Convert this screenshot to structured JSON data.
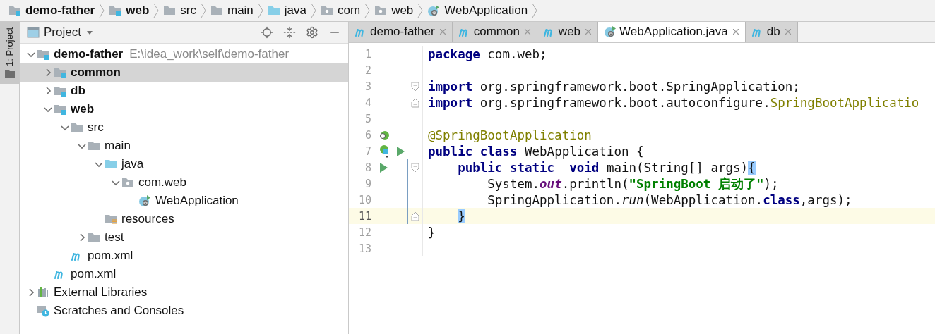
{
  "breadcrumbs": [
    {
      "label": "demo-father",
      "kind": "module"
    },
    {
      "label": "web",
      "kind": "module"
    },
    {
      "label": "src",
      "kind": "folder"
    },
    {
      "label": "main",
      "kind": "folder"
    },
    {
      "label": "java",
      "kind": "source"
    },
    {
      "label": "com",
      "kind": "package"
    },
    {
      "label": "web",
      "kind": "package"
    },
    {
      "label": "WebApplication",
      "kind": "class"
    }
  ],
  "side_tab": {
    "label": "1: Project",
    "selected": true
  },
  "project_panel": {
    "title": "Project"
  },
  "tree": [
    {
      "label": "demo-father",
      "hint": "E:\\idea_work\\self\\demo-father",
      "kind": "module",
      "expanded": true,
      "selected": false,
      "children": [
        {
          "label": "common",
          "kind": "module",
          "expanded": false,
          "selected": true
        },
        {
          "label": "db",
          "kind": "module",
          "expanded": false,
          "selected": false
        },
        {
          "label": "web",
          "kind": "module",
          "expanded": true,
          "selected": false,
          "children": [
            {
              "label": "src",
              "kind": "folder",
              "expanded": true,
              "selected": false,
              "children": [
                {
                  "label": "main",
                  "kind": "folder",
                  "expanded": true,
                  "selected": false,
                  "children": [
                    {
                      "label": "java",
                      "kind": "source",
                      "expanded": true,
                      "selected": false,
                      "children": [
                        {
                          "label": "com.web",
                          "kind": "package",
                          "expanded": true,
                          "selected": false,
                          "children": [
                            {
                              "label": "WebApplication",
                              "kind": "class",
                              "selected": false
                            }
                          ]
                        }
                      ]
                    },
                    {
                      "label": "resources",
                      "kind": "resources",
                      "selected": false
                    }
                  ]
                },
                {
                  "label": "test",
                  "kind": "folder",
                  "expanded": false,
                  "selected": false
                }
              ]
            },
            {
              "label": "pom.xml",
              "kind": "maven",
              "selected": false
            }
          ]
        },
        {
          "label": "pom.xml",
          "kind": "maven",
          "selected": false
        }
      ]
    },
    {
      "label": "External Libraries",
      "kind": "libraries",
      "expanded": false,
      "selected": false
    },
    {
      "label": "Scratches and Consoles",
      "kind": "scratches",
      "selected": false
    }
  ],
  "editor_tabs": [
    {
      "label": "demo-father",
      "kind": "maven",
      "selected": false
    },
    {
      "label": "common",
      "kind": "maven",
      "selected": false
    },
    {
      "label": "web",
      "kind": "maven",
      "selected": false
    },
    {
      "label": "WebApplication.java",
      "kind": "class",
      "selected": true
    },
    {
      "label": "db",
      "kind": "maven",
      "selected": false
    }
  ],
  "code": [
    {
      "number": "1",
      "current": false,
      "scope": false,
      "tokens": [
        {
          "text": "package",
          "kind": "keyword"
        },
        {
          "text": " com.web;",
          "kind": "plain"
        }
      ]
    },
    {
      "number": "2",
      "current": false,
      "scope": false
    },
    {
      "number": "3",
      "current": false,
      "scope": false,
      "fold_start": true,
      "tokens": [
        {
          "text": "import",
          "kind": "keyword"
        },
        {
          "text": " org.springframework.boot.SpringApplication;",
          "kind": "plain"
        }
      ]
    },
    {
      "number": "4",
      "current": false,
      "scope": false,
      "fold_end": true,
      "tokens": [
        {
          "text": "import",
          "kind": "keyword"
        },
        {
          "text": " org.springframework.boot.autoconfigure.",
          "kind": "plain"
        },
        {
          "text": "SpringBootApplicatio",
          "kind": "annotation"
        }
      ]
    },
    {
      "number": "5",
      "current": false,
      "scope": false
    },
    {
      "number": "6",
      "current": false,
      "scope": false,
      "marks": [
        {
          "kind": "bean"
        }
      ],
      "tokens": [
        {
          "text": "@SpringBootApplication",
          "kind": "annotation"
        }
      ]
    },
    {
      "number": "7",
      "current": false,
      "scope": false,
      "marks": [
        {
          "kind": "bean-class"
        },
        {
          "kind": "run"
        }
      ],
      "tokens": [
        {
          "text": "public",
          "kind": "keyword"
        },
        {
          "text": " class",
          "kind": "keyword"
        },
        {
          "text": " WebApplication {",
          "kind": "plain"
        }
      ]
    },
    {
      "number": "8",
      "current": false,
      "scope": true,
      "fold_start": true,
      "marks": [
        {
          "kind": "run"
        }
      ],
      "tokens": [
        {
          "text": "    public",
          "kind": "keyword"
        },
        {
          "text": " static",
          "kind": "keyword"
        },
        {
          "text": "  void",
          "kind": "keyword"
        },
        {
          "text": " main(String[] args)",
          "kind": "plain"
        },
        {
          "text": "{",
          "kind": "brace"
        }
      ]
    },
    {
      "number": "9",
      "current": false,
      "scope": true,
      "tokens": [
        {
          "text": "        System.",
          "kind": "plain"
        },
        {
          "text": "out",
          "kind": "field"
        },
        {
          "text": ".println(",
          "kind": "plain"
        },
        {
          "text": "\"SpringBoot 启动了\"",
          "kind": "string"
        },
        {
          "text": ");",
          "kind": "plain"
        }
      ]
    },
    {
      "number": "10",
      "current": false,
      "scope": true,
      "tokens": [
        {
          "text": "        SpringApplication.",
          "kind": "plain"
        },
        {
          "text": "run",
          "kind": "call"
        },
        {
          "text": "(WebApplication.",
          "kind": "plain"
        },
        {
          "text": "class",
          "kind": "keyword"
        },
        {
          "text": ",args);",
          "kind": "plain"
        }
      ]
    },
    {
      "number": "11",
      "current": true,
      "scope": true,
      "fold_end": true,
      "tokens": [
        {
          "text": "    }",
          "kind": "brace"
        }
      ]
    },
    {
      "number": "12",
      "current": false,
      "scope": false,
      "tokens": [
        {
          "text": "}",
          "kind": "plain"
        }
      ]
    },
    {
      "number": "13",
      "current": false,
      "scope": false
    }
  ]
}
